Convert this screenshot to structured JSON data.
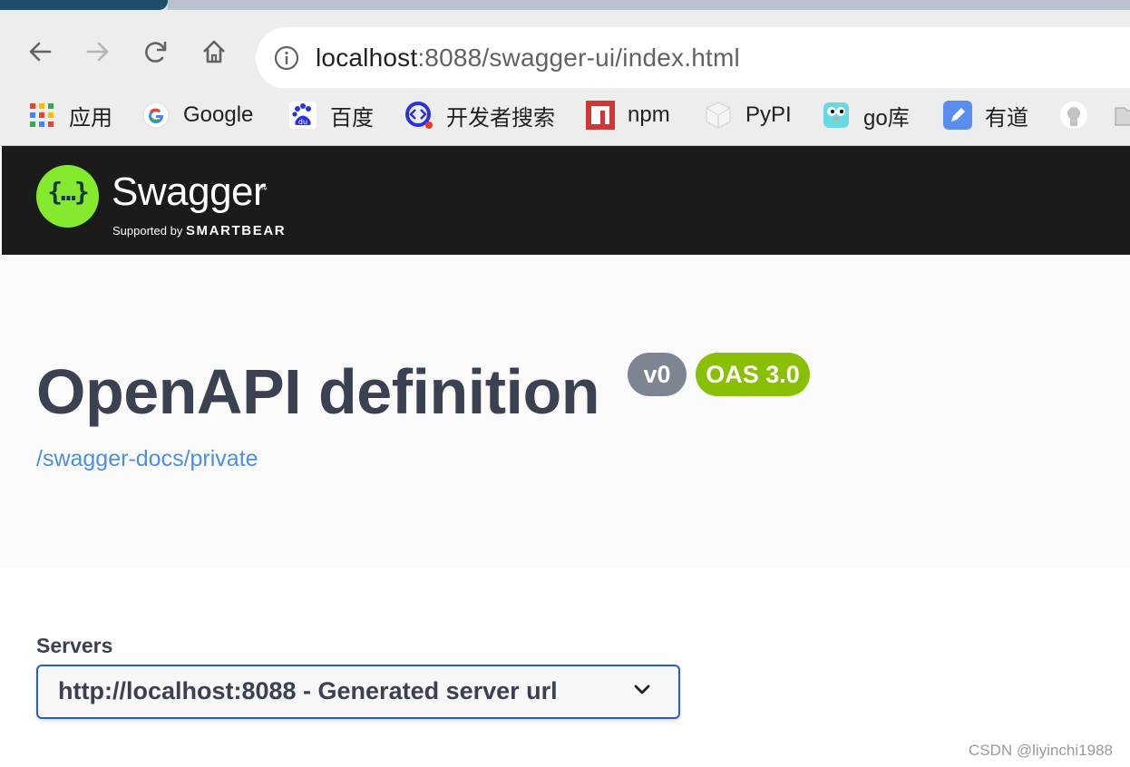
{
  "browser": {
    "url_host": "localhost",
    "url_rest": ":8088/swagger-ui/index.html",
    "bookmarks": [
      {
        "label": "应用",
        "icon": "apps-grid-icon"
      },
      {
        "label": "Google",
        "icon": "google-icon"
      },
      {
        "label": "百度",
        "icon": "baidu-icon"
      },
      {
        "label": "开发者搜索",
        "icon": "dev-search-icon"
      },
      {
        "label": "npm",
        "icon": "npm-icon"
      },
      {
        "label": "PyPI",
        "icon": "pypi-icon"
      },
      {
        "label": "go库",
        "icon": "gopher-icon"
      },
      {
        "label": "有道",
        "icon": "youdao-icon"
      },
      {
        "label": "",
        "icon": "github-icon"
      },
      {
        "label": "",
        "icon": "folder-icon"
      }
    ]
  },
  "topbar": {
    "logo_glyph": "{…}",
    "brand": "Swagger",
    "trademark": "™",
    "supported_prefix": "Supported by ",
    "supported_brand": "SMARTBEAR"
  },
  "info": {
    "title": "OpenAPI definition",
    "version": "v0",
    "oas": "OAS 3.0",
    "spec_link": "/swagger-docs/private"
  },
  "servers": {
    "label": "Servers",
    "selected": "http://localhost:8088 - Generated server url"
  },
  "watermark": "CSDN @liyinchi1988",
  "colors": {
    "swagger_green": "#85ea2d",
    "topbar_bg": "#1b1b1b",
    "title": "#3b4151",
    "badge_version": "#7d8492",
    "badge_oas": "#89bf04",
    "link": "#4990e2",
    "select_border": "#2a5ec6"
  }
}
